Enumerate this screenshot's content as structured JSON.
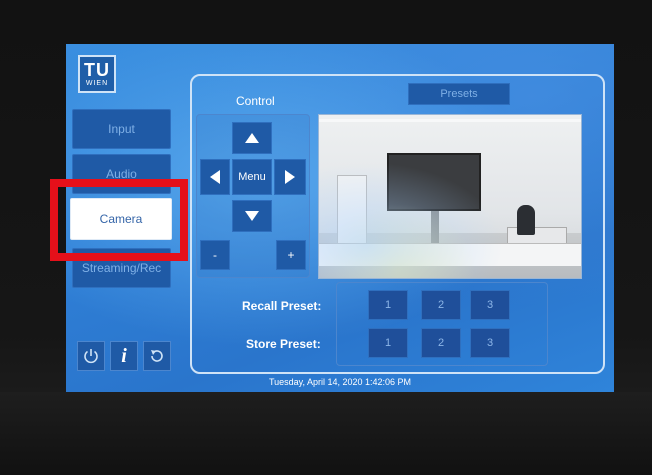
{
  "logo": {
    "line1": "TU",
    "line2": "WIEN"
  },
  "sidebar": {
    "items": [
      {
        "label": "Input"
      },
      {
        "label": "Audio"
      },
      {
        "label": "Camera"
      },
      {
        "label": "Streaming/Rec"
      }
    ],
    "active_index": 2
  },
  "bottom_icons": [
    "power-icon",
    "info-icon",
    "refresh-icon"
  ],
  "control": {
    "title": "Control",
    "menu_label": "Menu",
    "minus_label": "-",
    "plus_label": "+"
  },
  "presets_button": {
    "label": "Presets"
  },
  "recall": {
    "label": "Recall Preset:",
    "buttons": [
      "1",
      "2",
      "3"
    ]
  },
  "store": {
    "label": "Store Preset:",
    "buttons": [
      "1",
      "2",
      "3"
    ]
  },
  "footer": {
    "datetime": "Tuesday, April 14, 2020 1:42:06 PM"
  },
  "colors": {
    "screen_bg": "#2f7fd6",
    "button_bg": "#1f5aa6",
    "active_bg": "#ffffff",
    "highlight": "#e5101a"
  }
}
